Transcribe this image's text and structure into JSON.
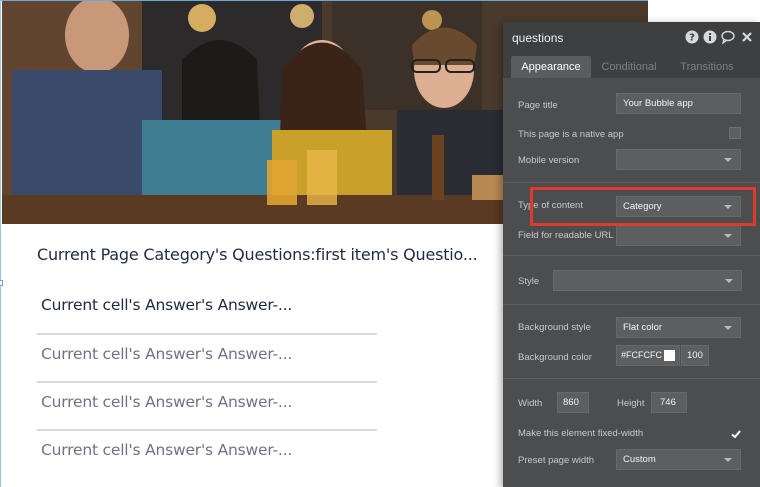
{
  "canvas": {
    "heading": "Current Page Category's Questions:first item's Questio...",
    "answers": [
      "Current cell's Answer's Answer-...",
      "Current cell's Answer's Answer-...",
      "Current cell's Answer's Answer-...",
      "Current cell's Answer's Answer-..."
    ]
  },
  "panel": {
    "title": "questions",
    "tabs": [
      "Appearance",
      "Conditional",
      "Transitions"
    ],
    "active_tab": "Appearance",
    "page_title_label": "Page title",
    "page_title_value": "Your Bubble app",
    "native_app_label": "This page is a native app",
    "mobile_version_label": "Mobile version",
    "mobile_version_value": "",
    "type_of_content_label": "Type of content",
    "type_of_content_value": "Category",
    "readable_url_label": "Field for readable URL",
    "readable_url_value": "",
    "style_label": "Style",
    "style_value": "",
    "bg_style_label": "Background style",
    "bg_style_value": "Flat color",
    "bg_color_label": "Background color",
    "bg_color_value": "#FCFCFC",
    "bg_opacity": "100",
    "width_label": "Width",
    "width_value": "860",
    "height_label": "Height",
    "height_value": "746",
    "fixed_width_label": "Make this element fixed-width",
    "fixed_width_checked": true,
    "preset_width_label": "Preset page width",
    "preset_width_value": "Custom"
  },
  "colors": {
    "panel_bg": "#4b4d4f",
    "highlight": "#e03a2e",
    "heading_text": "#1f2a44"
  },
  "icons": [
    "help-icon",
    "info-icon",
    "comment-icon",
    "close-icon",
    "chevron-down-icon",
    "checkmark-icon"
  ]
}
